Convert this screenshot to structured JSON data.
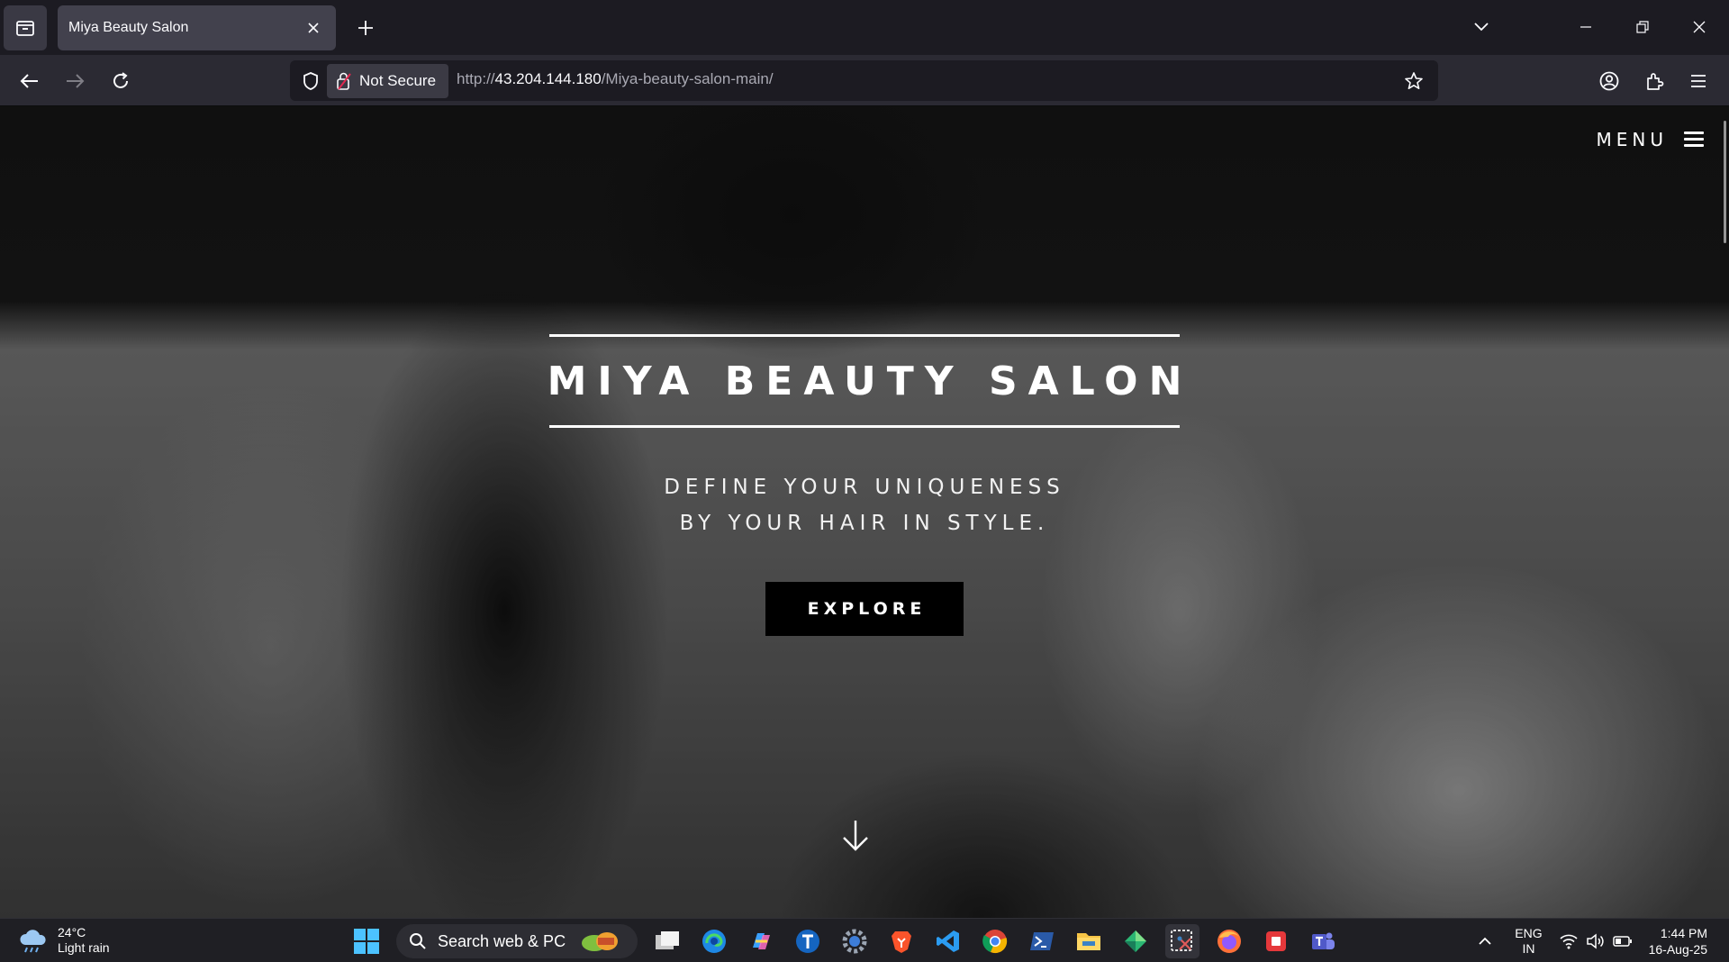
{
  "browser": {
    "tab_title": "Miya Beauty Salon",
    "security_label": "Not Secure",
    "url_prefix": "http://",
    "url_host": "43.204.144.180",
    "url_path": "/Miya-beauty-salon-main/"
  },
  "page": {
    "menu_label": "MENU",
    "hero_title": "MIYA BEAUTY SALON",
    "tagline_line1": "DEFINE YOUR UNIQUENESS",
    "tagline_line2": "BY YOUR HAIR IN STYLE.",
    "explore_label": "EXPLORE"
  },
  "taskbar": {
    "temperature": "24°C",
    "weather": "Light rain",
    "search_placeholder": "Search web & PC",
    "lang_top": "ENG",
    "lang_bottom": "IN",
    "time": "1:44 PM",
    "date": "16-Aug-25",
    "apps": [
      "start-icon",
      "search",
      "widgets-icon",
      "task-view-icon",
      "edge-icon",
      "copilot-icon",
      "t-app-icon",
      "settings-icon",
      "brave-icon",
      "vscode-icon",
      "chrome-icon",
      "powershell-icon",
      "file-explorer-icon",
      "store-icon",
      "snipping-tool-icon",
      "firefox-icon",
      "presentation-icon",
      "teams-icon"
    ]
  },
  "colors": {
    "chrome_bg": "#1c1b22",
    "toolbar_bg": "#2b2a33",
    "accent_black": "#000000",
    "hero_text": "#ffffff"
  }
}
